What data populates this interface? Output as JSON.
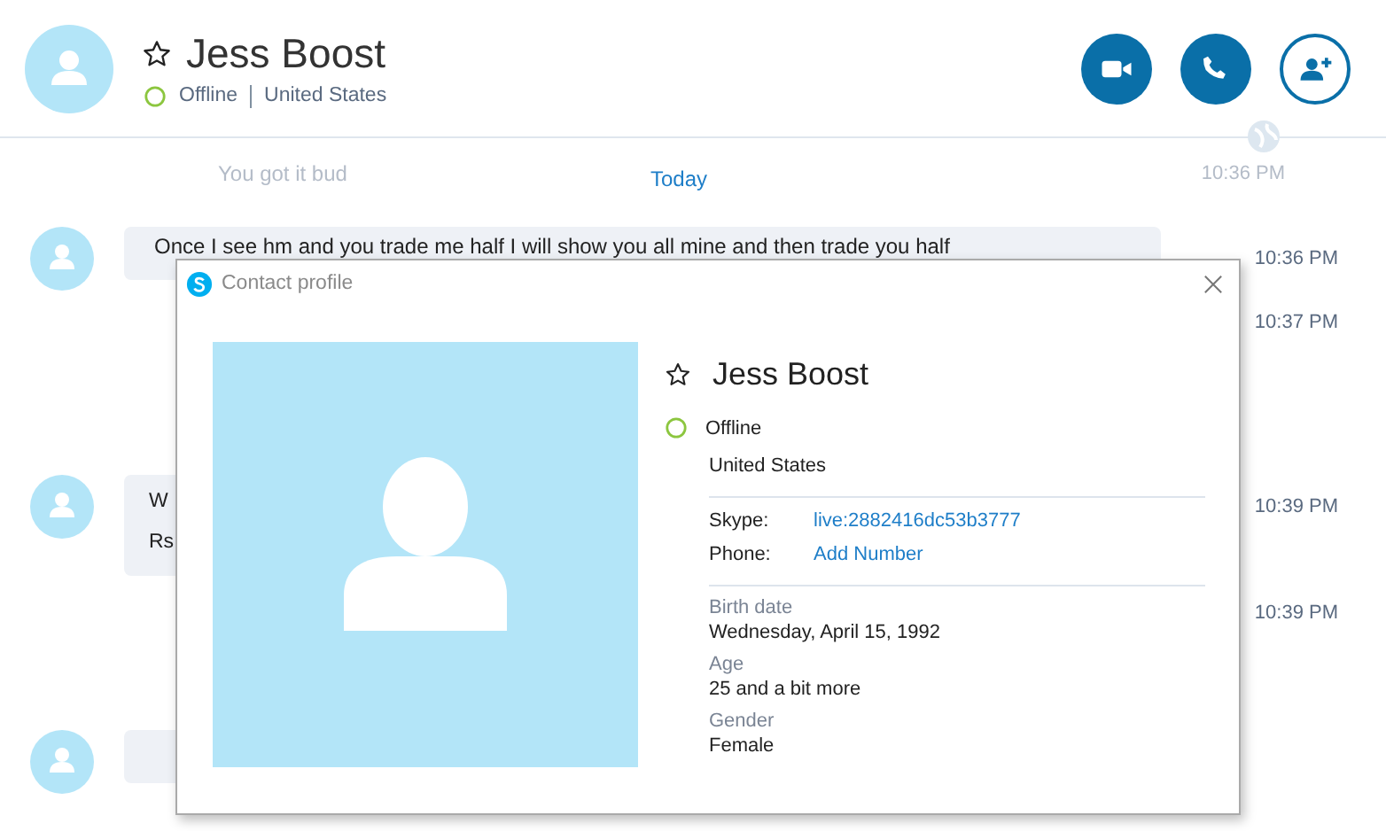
{
  "header": {
    "name": "Jess Boost",
    "favorite": false,
    "status": {
      "label": "Offline",
      "online": false
    },
    "location": "United States"
  },
  "chat": {
    "faded_message": {
      "text": "You got it bud",
      "time": "10:36 PM"
    },
    "date_divider": "Today",
    "messages": [
      {
        "avatar": true,
        "lines": [
          "Once I see hm and you trade me half I will show you all mine and then trade you half"
        ],
        "time": "10:36 PM"
      },
      {
        "avatar": false,
        "time": "10:37 PM"
      },
      {
        "avatar": true,
        "lines": [
          "W",
          "Rs"
        ],
        "time": "10:39 PM"
      },
      {
        "avatar": false,
        "time": "10:39 PM"
      },
      {
        "avatar": true
      }
    ]
  },
  "dialog": {
    "title": "Contact profile",
    "name": "Jess Boost",
    "favorite": false,
    "status": {
      "label": "Offline",
      "online": false
    },
    "location": "United States",
    "fields": [
      {
        "label": "Skype:",
        "value": "live:2882416dc53b3777",
        "kind": "link"
      },
      {
        "label": "Phone:",
        "value": "Add Number",
        "kind": "link"
      }
    ],
    "details": [
      {
        "label": "Birth date",
        "value": "Wednesday, April 15, 1992"
      },
      {
        "label": "Age",
        "value": "25 and a bit more"
      },
      {
        "label": "Gender",
        "value": "Female"
      }
    ]
  }
}
